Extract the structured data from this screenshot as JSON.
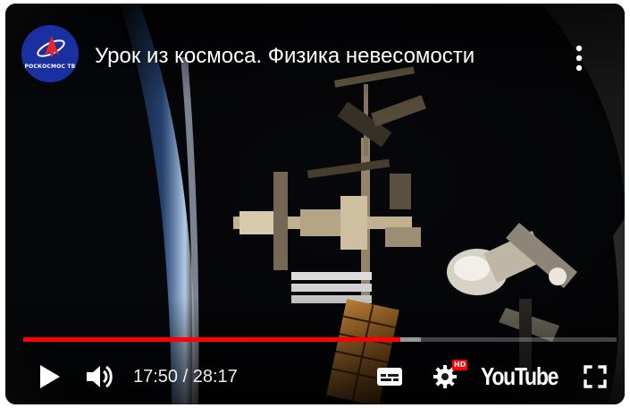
{
  "channel": {
    "avatar_text": "РОСКОСМОС ТВ",
    "brand_color": "#1a2fa0"
  },
  "video": {
    "title": "Урок из космоса. Физика невесомости"
  },
  "player": {
    "progress_fraction": 0.636,
    "buffered_fraction": 0.67,
    "progress_color": "#ff0000",
    "current_time": "17:50",
    "duration": "28:17",
    "time_text": "17:50 / 28:17",
    "hd_badge": "HD",
    "logo_text": "YouTube"
  },
  "icons": {
    "play": "play-icon",
    "volume": "volume-icon",
    "subtitles": "subtitles-icon",
    "settings": "settings-gear-icon",
    "fullscreen": "fullscreen-icon",
    "more": "more-vertical-icon"
  }
}
